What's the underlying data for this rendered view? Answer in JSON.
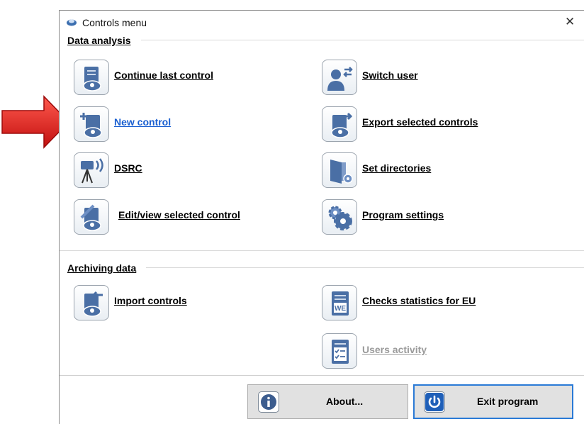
{
  "window": {
    "title": "Controls menu",
    "close_glyph": "✕"
  },
  "sections": {
    "data_analysis": "Data analysis",
    "archiving_data": "Archiving data"
  },
  "items": {
    "continue_last_control": "Continue last control",
    "new_control": "New control",
    "dsrc": "DSRC",
    "edit_view_selected_control": "Edit/view selected control",
    "switch_user": "Switch user",
    "export_selected_controls": "Export selected controls",
    "set_directories": "Set directories",
    "program_settings": "Program settings",
    "import_controls": "Import controls",
    "checks_statistics_for_eu": "Checks statistics for EU",
    "users_activity": "Users activity"
  },
  "icon_text": {
    "we_badge": "WE"
  },
  "footer": {
    "about_label": "About...",
    "exit_label": "Exit program"
  },
  "colors": {
    "accent": "#2a7ad6",
    "icon_blue": "#4a6fa5",
    "link": "#1a5fd0",
    "disabled": "#9a9a9a",
    "arrow": "#e8201e"
  }
}
